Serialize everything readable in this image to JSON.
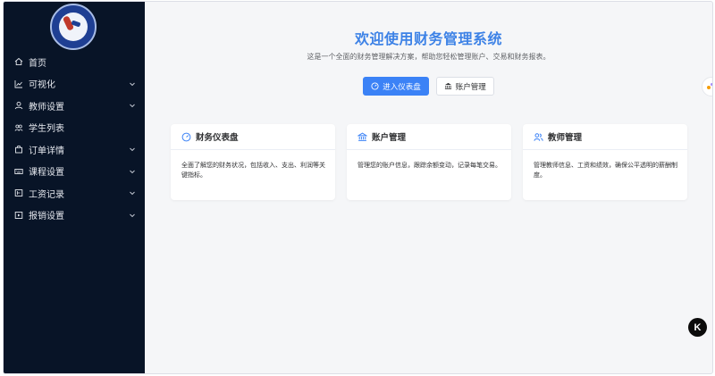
{
  "sidebar": {
    "items": [
      {
        "label": "首页",
        "icon": "home-icon",
        "expandable": false
      },
      {
        "label": "可视化",
        "icon": "chart-icon",
        "expandable": true
      },
      {
        "label": "教师设置",
        "icon": "user-icon",
        "expandable": true
      },
      {
        "label": "学生列表",
        "icon": "list-icon",
        "expandable": false
      },
      {
        "label": "订单详情",
        "icon": "bag-icon",
        "expandable": true
      },
      {
        "label": "课程设置",
        "icon": "keyboard-icon",
        "expandable": true
      },
      {
        "label": "工资记录",
        "icon": "wallet-icon",
        "expandable": true
      },
      {
        "label": "报销设置",
        "icon": "receipt-icon",
        "expandable": true
      }
    ]
  },
  "main": {
    "title": "欢迎使用财务管理系统",
    "subtitle": "这是一个全面的财务管理解决方案，帮助您轻松管理账户、交易和财务报表。",
    "buttons": {
      "dashboard": "进入仪表盘",
      "accounts": "账户管理"
    },
    "cards": [
      {
        "title": "财务仪表盘",
        "icon": "dashboard-icon",
        "desc": "全面了解您的财务状况，包括收入、支出、利润等关键指标。"
      },
      {
        "title": "账户管理",
        "icon": "bank-icon",
        "desc": "管理您的账户信息，跟踪余额变动，记录每笔交易。"
      },
      {
        "title": "教师管理",
        "icon": "users-icon",
        "desc": "管理教师信息、工资和绩效，确保公平透明的薪酬制度。"
      }
    ]
  },
  "floating": {
    "badge": "K"
  },
  "colors": {
    "sidebar_bg": "#081427",
    "primary": "#3b82f6",
    "title": "#3d82e6"
  }
}
